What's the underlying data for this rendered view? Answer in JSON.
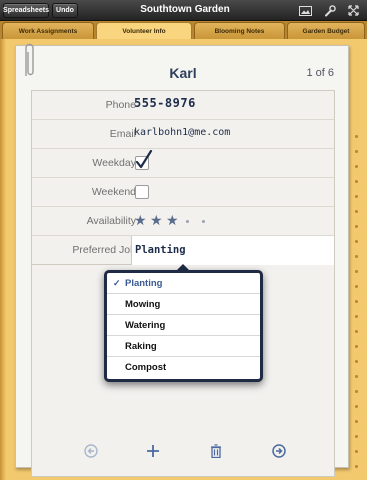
{
  "toolbar": {
    "spreadsheets_label": "Spreadsheets",
    "undo_label": "Undo",
    "title": "Southtown Garden",
    "icons": [
      "image-icon",
      "wrench-icon",
      "fullscreen-icon"
    ]
  },
  "tabs": [
    {
      "label": "Work Assignments",
      "active": false
    },
    {
      "label": "Volunteer Info",
      "active": true
    },
    {
      "label": "Blooming Notes",
      "active": false
    },
    {
      "label": "Garden Budget",
      "active": false
    }
  ],
  "card": {
    "title": "Karl",
    "counter": "1 of 6"
  },
  "fields": {
    "phone": {
      "label": "Phone",
      "value": "555-8976"
    },
    "email": {
      "label": "Email",
      "value": "karlbohn1@me.com"
    },
    "weekday": {
      "label": "Weekday",
      "checked": true
    },
    "weekend": {
      "label": "Weekend",
      "checked": false
    },
    "availability": {
      "label": "Availability",
      "rating": 3,
      "max": 5
    },
    "preferred_job": {
      "label": "Preferred Job",
      "value": "Planting"
    }
  },
  "dropdown": {
    "options": [
      "Planting",
      "Mowing",
      "Watering",
      "Raking",
      "Compost"
    ],
    "selected": "Planting",
    "check_glyph": "✓"
  },
  "bottom_bar": {
    "icons": [
      "previous-icon",
      "add-icon",
      "trash-icon",
      "next-icon"
    ]
  },
  "colors": {
    "accent": "#3b5a94",
    "notebook": "#f3c96e"
  }
}
